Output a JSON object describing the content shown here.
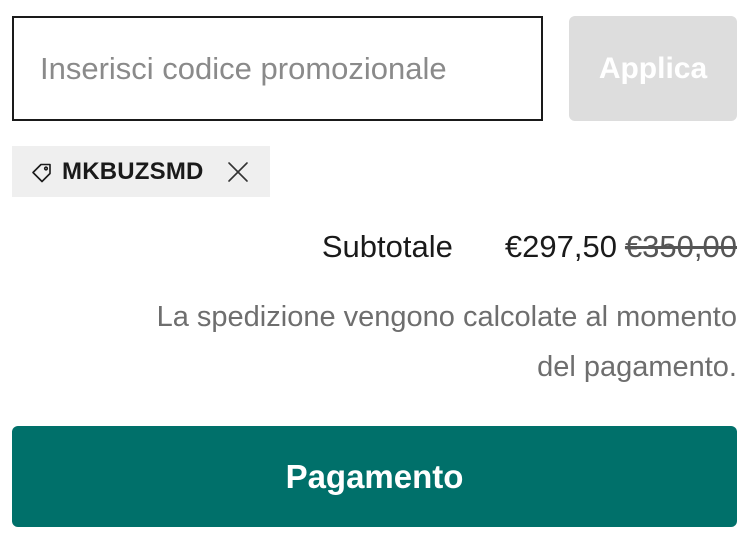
{
  "promo": {
    "input_value": "",
    "placeholder": "Inserisci codice promozionale",
    "apply_label": "Applica"
  },
  "applied_discount": {
    "code": "MKBUZSMD",
    "icon": "tag-icon",
    "remove_icon": "close-icon"
  },
  "summary": {
    "subtotal_label": "Subtotale",
    "subtotal_price": "€297,50",
    "original_price": "€350,00",
    "shipping_note": "La spedizione vengono calcolate al momento del pagamento."
  },
  "checkout": {
    "button_label": "Pagamento"
  },
  "colors": {
    "checkout_button": "#00706a",
    "apply_button_disabled": "#dddddd",
    "chip_background": "#efefef",
    "input_border": "#1a1a1a",
    "muted_text": "#6e6e6e"
  }
}
